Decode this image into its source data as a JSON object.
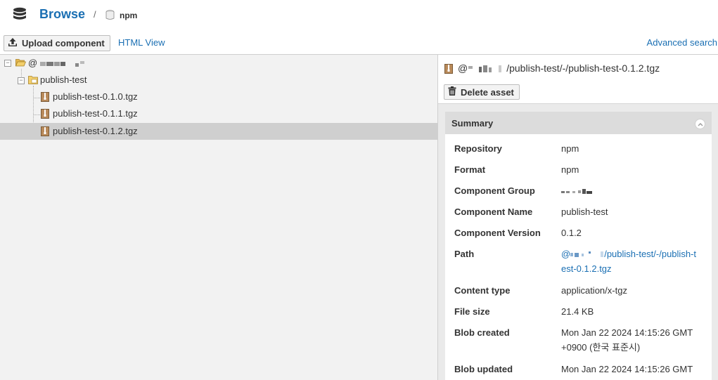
{
  "header": {
    "title": "Browse",
    "separator": "/",
    "repo": "npm"
  },
  "toolbar": {
    "upload_label": "Upload component",
    "html_view_label": "HTML View",
    "advanced_search_label": "Advanced search"
  },
  "tree": {
    "scope_label": "@",
    "package_label": "publish-test",
    "files": [
      {
        "label": "publish-test-0.1.0.tgz",
        "selected": false
      },
      {
        "label": "publish-test-0.1.1.tgz",
        "selected": false
      },
      {
        "label": "publish-test-0.1.2.tgz",
        "selected": true
      }
    ]
  },
  "asset": {
    "path_prefix": "@",
    "path_suffix": "/publish-test/-/publish-test-0.1.2.tgz",
    "delete_label": "Delete asset"
  },
  "summary": {
    "title": "Summary",
    "rows": [
      {
        "label": "Repository",
        "value": "npm"
      },
      {
        "label": "Format",
        "value": "npm"
      },
      {
        "label": "Component Group",
        "value": ""
      },
      {
        "label": "Component Name",
        "value": "publish-test"
      },
      {
        "label": "Component Version",
        "value": "0.1.2"
      },
      {
        "label": "Path",
        "value_prefix": "@",
        "value_line1": "/publish-test/-/publish-t",
        "value_line2": "est-0.1.2.tgz"
      },
      {
        "label": "Content type",
        "value": "application/x-tgz"
      },
      {
        "label": "File size",
        "value": "21.4 KB"
      },
      {
        "label": "Blob created",
        "value_line1": "Mon Jan 22 2024 14:15:26 GMT",
        "value_line2": "+0900 (한국 표준시)"
      },
      {
        "label": "Blob updated",
        "value_line1": "Mon Jan 22 2024 14:15:26 GMT"
      }
    ]
  },
  "colors": {
    "accent": "#1a6fb3",
    "selected_row": "#cfcfcf",
    "tree_bg": "#f2f2f2"
  }
}
